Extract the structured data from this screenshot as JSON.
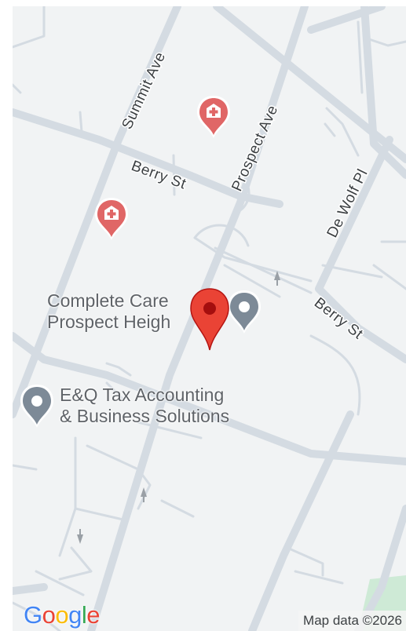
{
  "map": {
    "streets": {
      "summit": "Summit Ave",
      "prospect": "Prospect Ave",
      "berry_upper": "Berry St",
      "berry_lower": "Berry St",
      "dewolf": "De Wolf Pl"
    },
    "places": {
      "complete_care_line1": "Complete Care",
      "complete_care_line2": "Prospect Heigh",
      "eq_tax_line1": "E&Q Tax Accounting",
      "eq_tax_line2": "& Business Solutions"
    },
    "icons": {
      "hospital": "hospital-icon",
      "poi": "place-pin-icon",
      "selected": "red-location-pin-icon",
      "arrow": "one-way-arrow-icon"
    },
    "colors": {
      "background": "#f1f3f4",
      "road": "#d4dbe2",
      "hospital_red": "#e06666",
      "selected_red": "#ea4335",
      "poi_gray": "#7d8a97",
      "park_green": "#ceead6"
    }
  },
  "branding": {
    "logo_letters": [
      "G",
      "o",
      "o",
      "g",
      "l",
      "e"
    ],
    "logo_colors": [
      "#4285f4",
      "#ea4335",
      "#fbbc05",
      "#4285f4",
      "#34a853",
      "#ea4335"
    ],
    "attribution": "Map data ©2026"
  }
}
